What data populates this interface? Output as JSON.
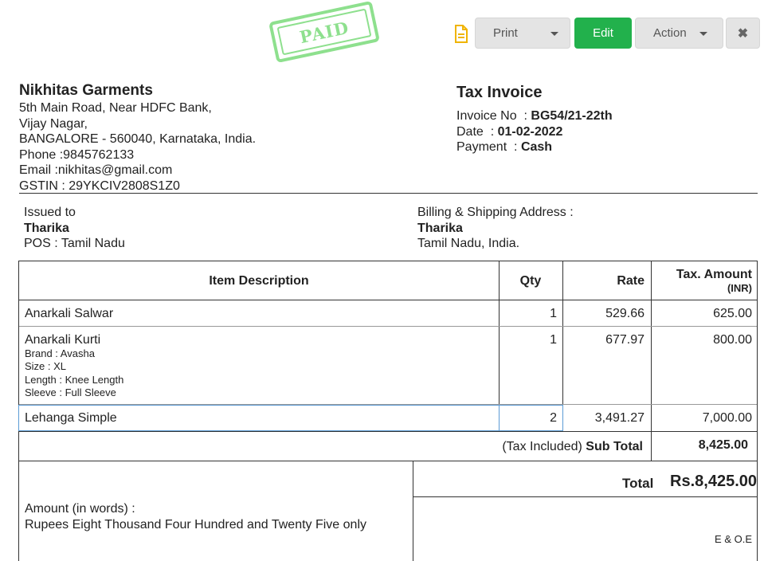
{
  "stamp": {
    "text": "PAID",
    "color": "#7dd87d"
  },
  "toolbar": {
    "print_label": "Print",
    "edit_label": "Edit",
    "action_label": "Action",
    "doc_icon": "document-icon",
    "close_icon": "close-icon",
    "accent": "#22b14c"
  },
  "company": {
    "name": "Nikhitas Garments",
    "address1": "5th Main Road, Near HDFC Bank,",
    "address2": "Vijay Nagar,",
    "address3": "BANGALORE - 560040, Karnataka, India.",
    "phone": "Phone :9845762133",
    "email": "Email :nikhitas@gmail.com",
    "gstin": "GSTIN : 29YKCIV2808S1Z0"
  },
  "invoice": {
    "title": "Tax Invoice",
    "number_label": "Invoice No  :",
    "number": "BG54/21-22th",
    "date_label": "Date  :",
    "date": "01-02-2022",
    "payment_label": "Payment  :",
    "payment": "Cash"
  },
  "issued": {
    "label": "Issued to",
    "name": "Tharika",
    "pos": "POS : Tamil Nadu"
  },
  "billing": {
    "label": "Billing & Shipping Address :",
    "name": "Tharika",
    "location": "Tamil Nadu, India."
  },
  "table": {
    "headers": {
      "description": "Item Description",
      "qty": "Qty",
      "rate": "Rate",
      "amount": "Tax. Amount",
      "amount_unit": "(INR)"
    },
    "rows": [
      {
        "description": "Anarkali Salwar",
        "qty": "1",
        "rate": "529.66",
        "amount": "625.00"
      },
      {
        "description": "Anarkali Kurti",
        "qty": "1",
        "rate": "677.97",
        "amount": "800.00",
        "details": [
          "Brand : Avasha",
          "Size : XL",
          "Length : Knee Length",
          "Sleeve : Full Sleeve"
        ]
      },
      {
        "description": "Lehanga Simple",
        "qty": "2",
        "rate": "3,491.27",
        "amount": "7,000.00"
      }
    ],
    "subtotal_prefix": "(Tax Included)",
    "subtotal_label": "Sub Total",
    "subtotal_value": "8,425.00"
  },
  "totals": {
    "words_label": "Amount (in words) :",
    "words": "Rupees Eight Thousand Four Hundred and Twenty Five only",
    "total_label": "Total",
    "total_value": "Rs.8,425.00",
    "eoe": "E & O.E"
  }
}
